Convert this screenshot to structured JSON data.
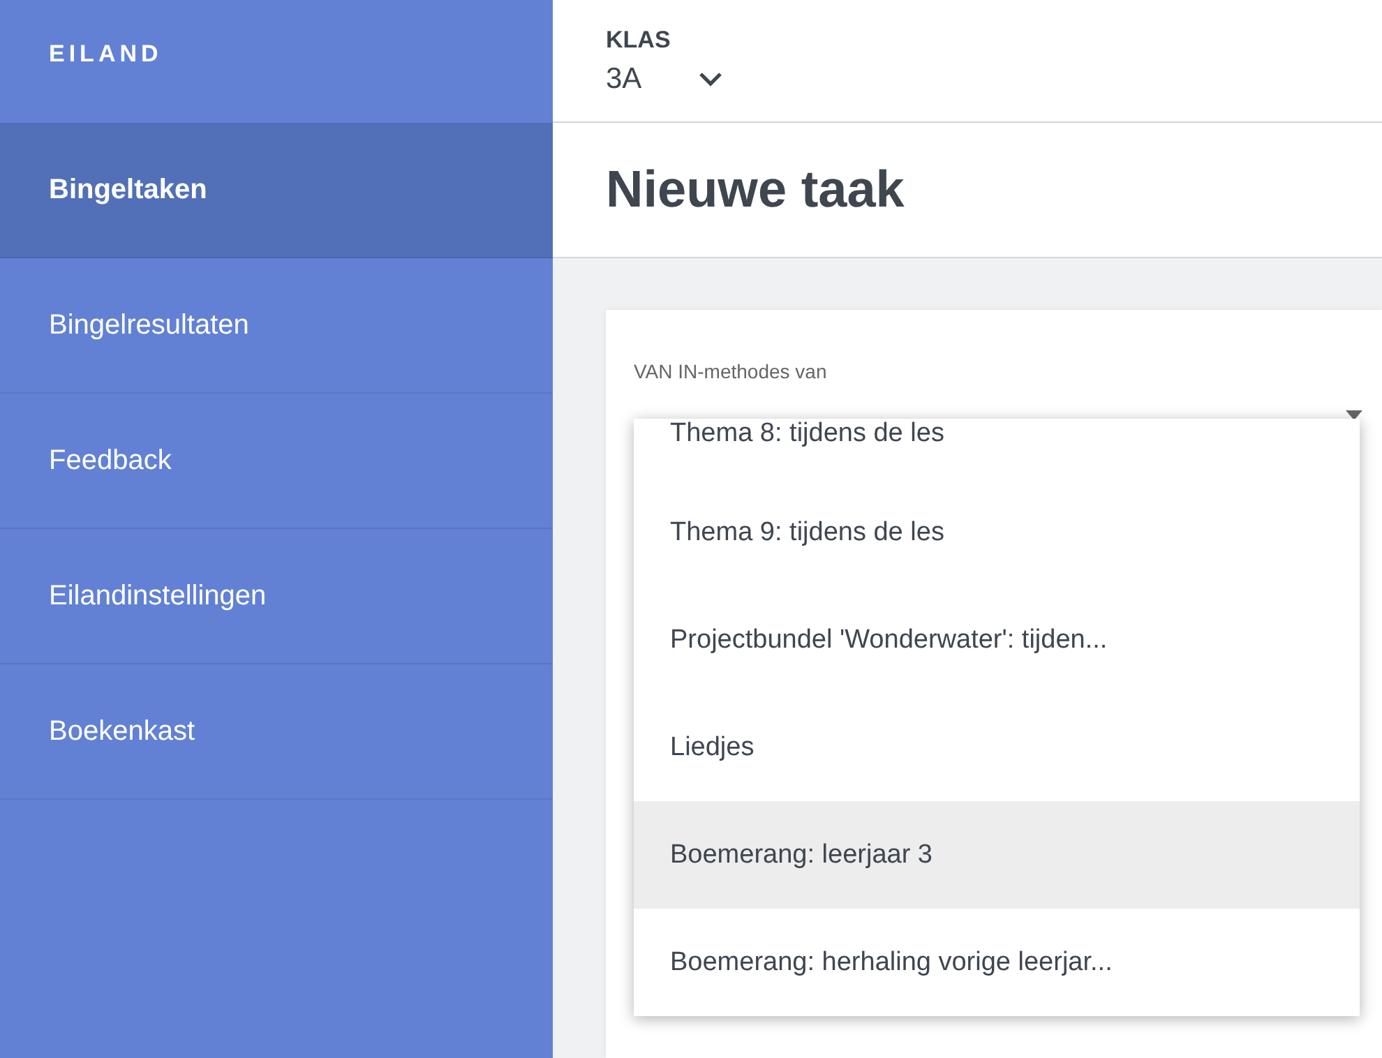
{
  "sidebar": {
    "logo": "EILAND",
    "items": [
      {
        "label": "Bingeltaken",
        "selected": true
      },
      {
        "label": "Bingelresultaten",
        "selected": false
      },
      {
        "label": "Feedback",
        "selected": false
      },
      {
        "label": "Eilandinstellingen",
        "selected": false
      },
      {
        "label": "Boekenkast",
        "selected": false
      }
    ]
  },
  "class_picker": {
    "label": "KLAS",
    "value": "3A"
  },
  "page_title": "Nieuwe taak",
  "form": {
    "field_label": "VAN IN-methodes van",
    "dropdown": {
      "options": [
        {
          "label": "Thema 8: tijdens de les",
          "selected": false
        },
        {
          "label": "Thema 9: tijdens de les",
          "selected": false
        },
        {
          "label": "Projectbundel 'Wonderwater': tijden...",
          "selected": false
        },
        {
          "label": "Liedjes",
          "selected": false
        },
        {
          "label": "Boemerang: leerjaar 3",
          "selected": true
        },
        {
          "label": "Boemerang: herhaling vorige leerjar...",
          "selected": false
        }
      ]
    }
  }
}
